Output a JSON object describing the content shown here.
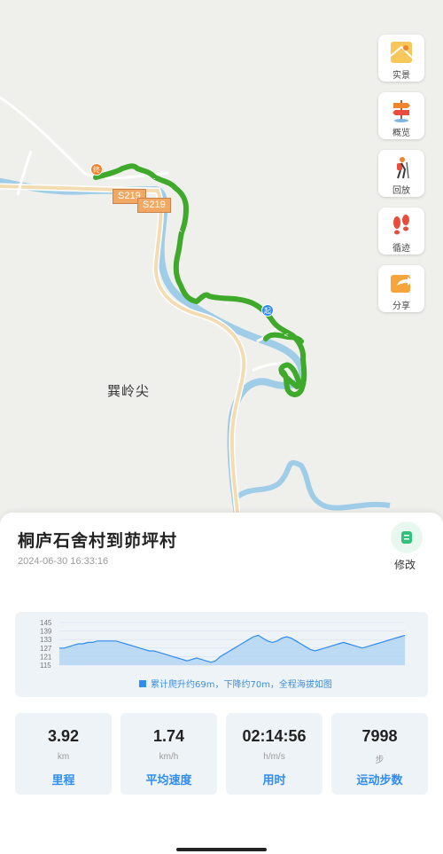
{
  "map": {
    "roads": [
      "S219",
      "S219"
    ],
    "place": "巽岭尖",
    "pins": {
      "end": "终",
      "start": "起"
    }
  },
  "toolbar": [
    {
      "label": "实景",
      "icon": "map-scene-icon"
    },
    {
      "label": "概览",
      "icon": "signpost-icon"
    },
    {
      "label": "回放",
      "icon": "hiker-icon"
    },
    {
      "label": "循迹",
      "icon": "footprints-icon"
    },
    {
      "label": "分享",
      "icon": "share-icon"
    }
  ],
  "route": {
    "title": "桐庐石舍村到茆坪村",
    "datetime": "2024-06-30 16:33:16",
    "edit_label": "修改"
  },
  "chart_data": {
    "type": "area",
    "y_ticks": [
      "145",
      "139",
      "133",
      "127",
      "121",
      "115"
    ],
    "ylim": [
      115,
      145
    ],
    "values": [
      127,
      127,
      128,
      129,
      130,
      130,
      131,
      131,
      132,
      132,
      132,
      132,
      132,
      131,
      130,
      129,
      128,
      127,
      126,
      125,
      125,
      124,
      123,
      122,
      121,
      120,
      119,
      118,
      119,
      120,
      119,
      118,
      117,
      118,
      121,
      123,
      125,
      127,
      129,
      131,
      133,
      135,
      136,
      134,
      132,
      131,
      132,
      134,
      135,
      134,
      132,
      130,
      128,
      126,
      125,
      126,
      127,
      128,
      129,
      130,
      131,
      130,
      129,
      128,
      127,
      128,
      129,
      130,
      131,
      132,
      133,
      134,
      135,
      136
    ],
    "legend": "累计爬升约69m，下降约70m，全程海拔如图",
    "colors": {
      "line": "#2f8cf0",
      "fill": "#a8cef3"
    }
  },
  "stats": [
    {
      "value": "3.92",
      "unit": "km",
      "label": "里程"
    },
    {
      "value": "1.74",
      "unit": "km/h",
      "label": "平均速度"
    },
    {
      "value": "02:14:56",
      "unit": "h/m/s",
      "label": "用时"
    },
    {
      "value": "7998",
      "unit": "步",
      "label": "运动步数"
    }
  ],
  "colors": {
    "track": "#3ea92a",
    "accent": "#2f8cf0",
    "river": "#9fcde8"
  }
}
